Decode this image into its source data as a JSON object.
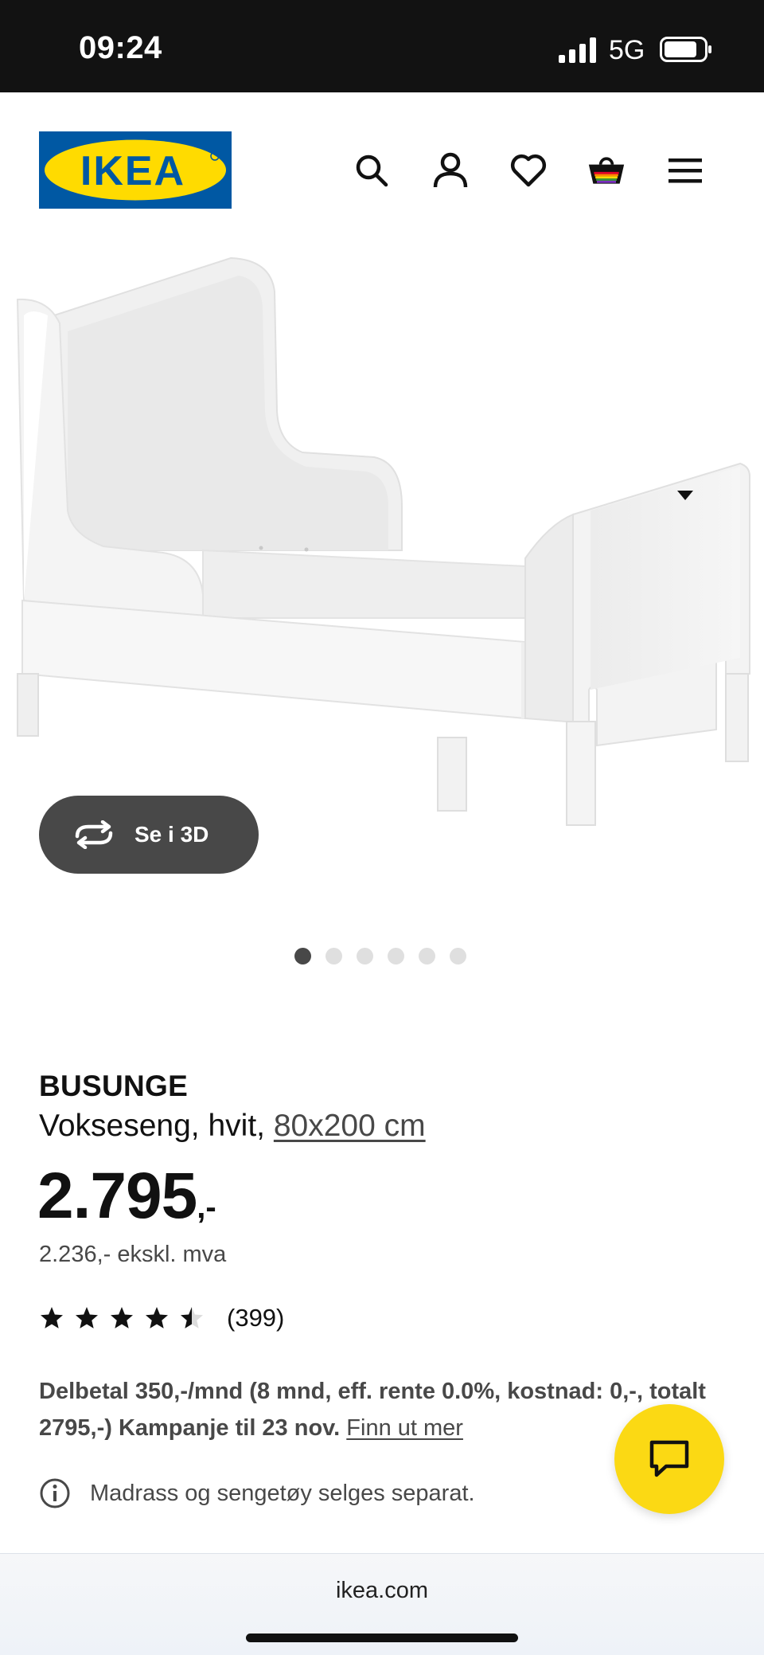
{
  "status_bar": {
    "time": "09:24",
    "network": "5G",
    "icons": [
      "signal-icon",
      "battery-icon"
    ]
  },
  "header": {
    "logo_text": "IKEA",
    "colors": {
      "logo_blue": "#0058a3",
      "logo_yellow": "#ffdb00"
    },
    "icons": [
      "search-icon",
      "account-icon",
      "heart-icon",
      "cart-icon",
      "menu-icon"
    ]
  },
  "gallery": {
    "view_3d_label": "Se i 3D",
    "dots_total": 6,
    "active_dot": 0
  },
  "product": {
    "name": "BUSUNGE",
    "description": "Vokseseng, hvit,",
    "size": "80x200 cm",
    "price_main": "2.795",
    "price_suffix": ",-",
    "price_ex_vat": "2.236,- ekskl. mva",
    "rating_value": 4.5,
    "rating_count": "(399)",
    "financing_text": "Delbetal 350,-/mnd (8 mnd, eff. rente 0.0%, kostnad: 0,-, totalt 2795,-) Kampanje til 23 nov.",
    "financing_link": "Finn ut mer",
    "notice": "Madrass og sengetøy selges separat."
  },
  "chat": {
    "icon": "chat-icon",
    "color": "#fbd914"
  },
  "browser": {
    "url": "ikea.com"
  }
}
